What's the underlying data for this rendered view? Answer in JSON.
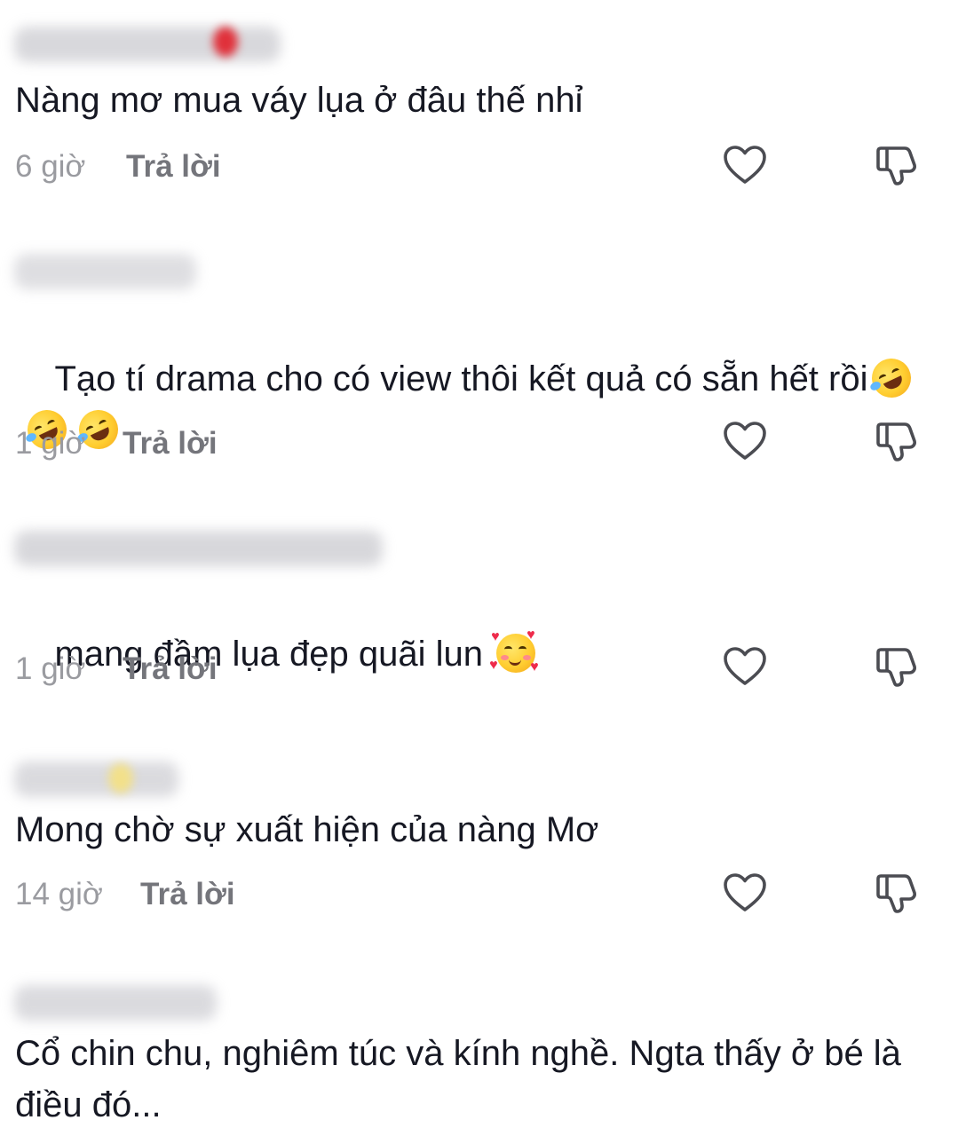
{
  "comments": [
    {
      "username": "",
      "text": "Nàng mơ mua váy lụa ở đâu thế nhỉ",
      "time": "6 giờ",
      "reply_label": "Trả lời",
      "emoji": []
    },
    {
      "username": "",
      "text": "Tạo tí drama cho có view thôi kết quả có sẵn hết rồi",
      "time": "1 giờ",
      "reply_label": "Trả lời",
      "emoji": [
        "rolling-on-floor-laughing",
        "rolling-on-floor-laughing",
        "rolling-on-floor-laughing"
      ]
    },
    {
      "username": "",
      "text": "mang đầm lụa đẹp quãi lun",
      "time": "1 giờ",
      "reply_label": "Trả lời",
      "emoji": [
        "smiling-face-with-hearts"
      ]
    },
    {
      "username": "",
      "text": "Mong chờ sự xuất hiện của nàng Mơ",
      "time": "14 giờ",
      "reply_label": "Trả lời",
      "emoji": []
    },
    {
      "username": "",
      "text": "Cổ chin chu, nghiêm túc và kính nghề. Ngta thấy ở bé là điều đó...",
      "time": "",
      "reply_label": "",
      "emoji": []
    }
  ],
  "icons": {
    "like": "heart-outline-icon",
    "dislike": "thumbs-down-outline-icon"
  },
  "colors": {
    "text": "#161823",
    "meta": "#9a9ba0",
    "reply": "#74757b",
    "icon": "#4b4c52"
  }
}
